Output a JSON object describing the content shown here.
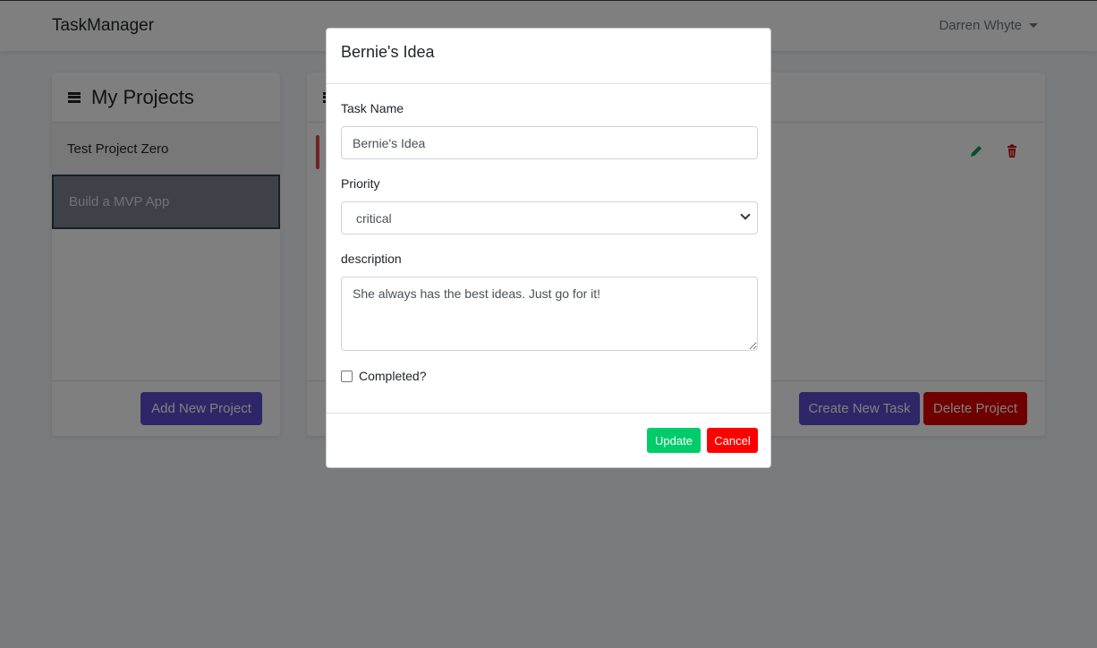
{
  "navbar": {
    "brand": "TaskManager",
    "user_name": "Darren Whyte"
  },
  "projects_panel": {
    "title": "My Projects",
    "icon": "list-icon",
    "items": [
      {
        "label": "Test Project Zero",
        "active": false
      },
      {
        "label": "Build a MVP App",
        "active": true
      }
    ],
    "add_button": "Add New Project"
  },
  "tasks_panel": {
    "task_priority_color": "#e04646",
    "edit_icon": "pencil-icon",
    "delete_icon": "trash-icon",
    "create_button": "Create New Task",
    "delete_button": "Delete Project"
  },
  "modal": {
    "title": "Bernie's Idea",
    "task_name_label": "Task Name",
    "task_name_value": "Bernie's Idea",
    "priority_label": "Priority",
    "priority_value": "critical",
    "description_label": "description",
    "description_value": "She always has the best ideas. Just go for it!",
    "completed_label": "Completed?",
    "completed": false,
    "update_button": "Update",
    "cancel_button": "Cancel"
  },
  "colors": {
    "primary": "#5a4fd0",
    "danger": "#e00000",
    "success": "#00cc6a",
    "cancel": "#ff0000"
  }
}
